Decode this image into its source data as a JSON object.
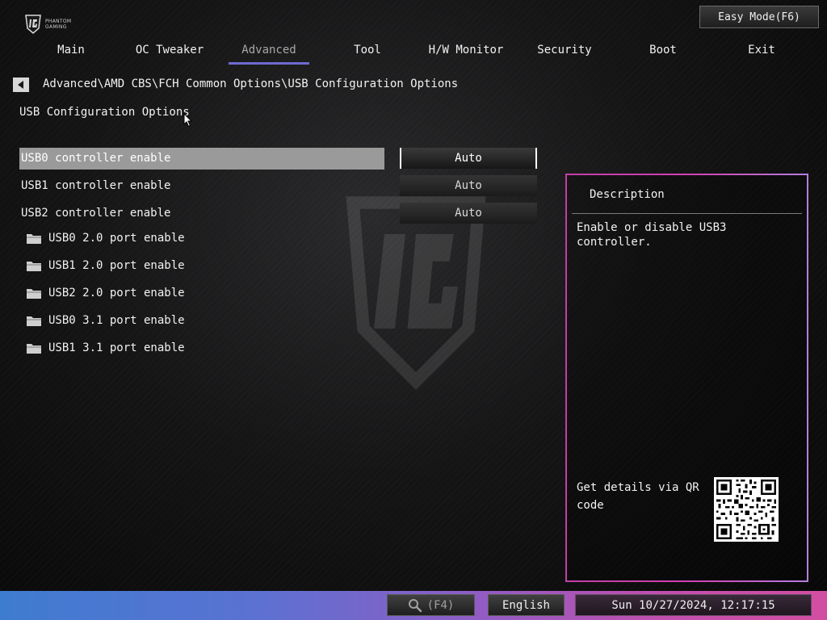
{
  "brand": {
    "logo_text_1": "PHANTOM",
    "logo_text_2": "GAMING"
  },
  "header": {
    "easy_mode_label": "Easy Mode(F6)",
    "tabs": [
      {
        "label": "Main"
      },
      {
        "label": "OC Tweaker"
      },
      {
        "label": "Advanced",
        "active": true
      },
      {
        "label": "Tool"
      },
      {
        "label": "H/W Monitor"
      },
      {
        "label": "Security"
      },
      {
        "label": "Boot"
      },
      {
        "label": "Exit"
      }
    ]
  },
  "breadcrumb": "Advanced\\AMD CBS\\FCH Common Options\\USB Configuration Options",
  "page_title": "USB Configuration Options",
  "options": [
    {
      "label": "USB0 controller enable",
      "value": "Auto",
      "selected": true
    },
    {
      "label": "USB1 controller enable",
      "value": "Auto"
    },
    {
      "label": "USB2 controller enable",
      "value": "Auto"
    }
  ],
  "submenus": [
    {
      "label": "USB0 2.0 port enable",
      "icon": "folder-icon"
    },
    {
      "label": "USB1 2.0 port enable",
      "icon": "folder-icon"
    },
    {
      "label": "USB2 2.0 port enable",
      "icon": "folder-icon"
    },
    {
      "label": "USB0 3.1 port enable",
      "icon": "folder-icon"
    },
    {
      "label": "USB1 3.1 port enable",
      "icon": "folder-icon"
    }
  ],
  "description": {
    "title": "Description",
    "text": "Enable or disable USB3 controller.",
    "qr_label": "Get details via QR code"
  },
  "footer": {
    "search_label": "(F4)",
    "language": "English",
    "datetime": "Sun 10/27/2024, 12:17:15"
  },
  "colors": {
    "accent_tab": "#6e6ad0",
    "selection_bg": "#9a9a9a",
    "panel_border": "#d43fb4",
    "footer_start": "#3e7cd0",
    "footer_end": "#d24ea2"
  }
}
